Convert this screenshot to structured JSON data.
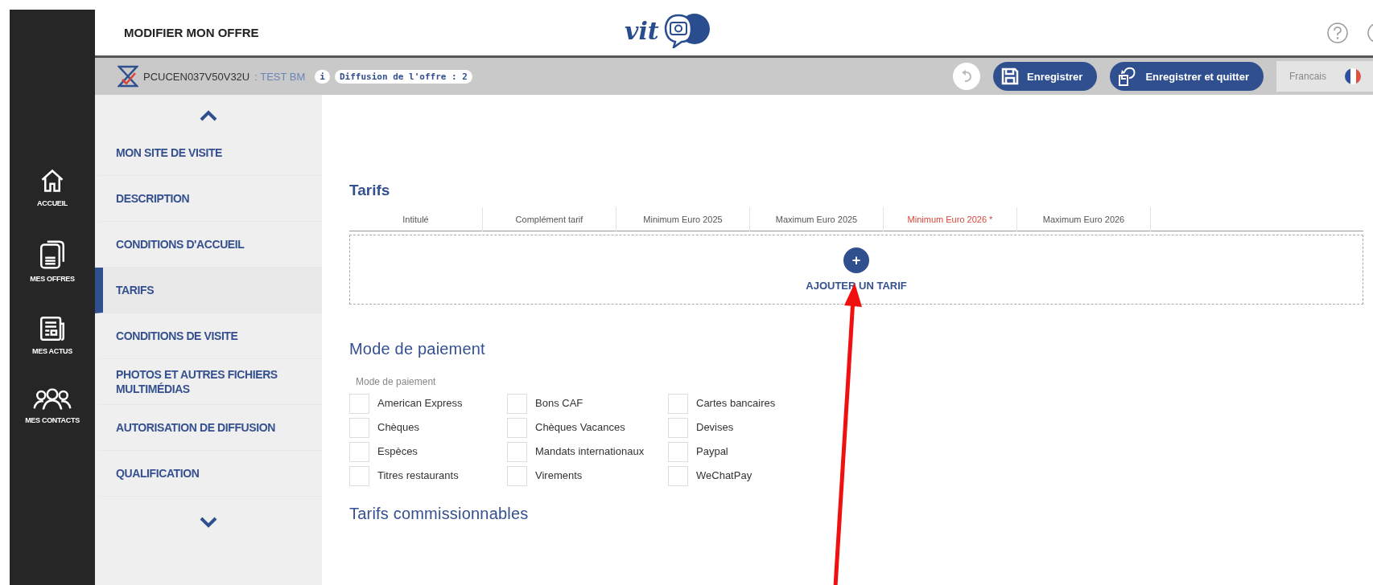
{
  "header": {
    "title": "MODIFIER MON OFFRE",
    "logo_text": "vit"
  },
  "toolbar": {
    "offer_code": "PCUCEN037V50V32U",
    "offer_name": ": TEST BM",
    "info_badge": "i",
    "diffusion": "Diffusion de l'offre : 2",
    "buttons": [
      {
        "label": "Enregistrer",
        "kind": "save"
      },
      {
        "label": "Enregistrer et quitter",
        "kind": "save-quit"
      }
    ],
    "language": "Francais"
  },
  "rail": [
    {
      "label": "ACCUEIL",
      "kind": "home"
    },
    {
      "label": "MES OFFRES",
      "kind": "offers"
    },
    {
      "label": "MES ACTUS",
      "kind": "news"
    },
    {
      "label": "MES CONTACTS",
      "kind": "contacts"
    }
  ],
  "nav": [
    {
      "label": "MON SITE DE VISITE",
      "selected": false
    },
    {
      "label": "DESCRIPTION",
      "selected": false
    },
    {
      "label": "CONDITIONS D'ACCUEIL",
      "selected": false
    },
    {
      "label": "TARIFS",
      "selected": true
    },
    {
      "label": "CONDITIONS DE VISITE",
      "selected": false
    },
    {
      "label": "PHOTOS ET AUTRES FICHIERS MULTIMÉDIAS",
      "selected": false
    },
    {
      "label": "AUTORISATION DE DIFFUSION",
      "selected": false
    },
    {
      "label": "QUALIFICATION",
      "selected": false
    }
  ],
  "tarifs": {
    "title": "Tarifs",
    "columns": [
      {
        "label": "Intitulé",
        "required": false
      },
      {
        "label": "Complément tarif",
        "required": false
      },
      {
        "label": "Minimum Euro 2025",
        "required": false
      },
      {
        "label": "Maximum Euro 2025",
        "required": false
      },
      {
        "label": "Minimum Euro 2026 *",
        "required": true
      },
      {
        "label": "Maximum Euro 2026",
        "required": false
      }
    ],
    "add_icon": "+",
    "add_label": "AJOUTER UN TARIF"
  },
  "payment": {
    "title": "Mode de paiement",
    "field_label": "Mode de paiement",
    "options": [
      {
        "label": "American Express",
        "checked": false
      },
      {
        "label": "Bons CAF",
        "checked": false
      },
      {
        "label": "Cartes bancaires",
        "checked": false
      },
      {
        "label": "Chèques",
        "checked": false
      },
      {
        "label": "Chèques Vacances",
        "checked": false
      },
      {
        "label": "Devises",
        "checked": false
      },
      {
        "label": "Espèces",
        "checked": false
      },
      {
        "label": "Mandats internationaux",
        "checked": false
      },
      {
        "label": "Paypal",
        "checked": false
      },
      {
        "label": "Titres restaurants",
        "checked": false
      },
      {
        "label": "Virements",
        "checked": false
      },
      {
        "label": "WeChatPay",
        "checked": false
      }
    ]
  },
  "next_section": {
    "title": "Tarifs commissionnables"
  }
}
